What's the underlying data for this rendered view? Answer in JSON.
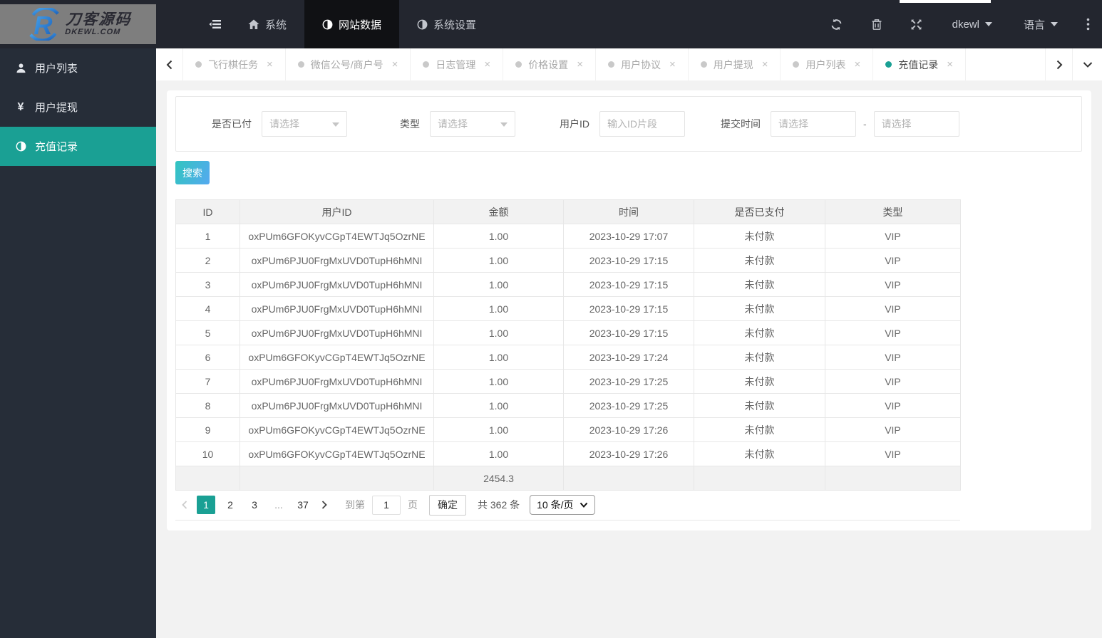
{
  "header": {
    "logo": {
      "title": "刀客源码",
      "subtitle": "DKEWL.COM"
    },
    "nav": [
      {
        "label": "系统",
        "icon": "home-icon",
        "active": false
      },
      {
        "label": "网站数据",
        "icon": "half-circle-icon",
        "active": true
      },
      {
        "label": "系统设置",
        "icon": "half-circle-icon",
        "active": false
      }
    ],
    "username": "dkewl",
    "language_label": "语言"
  },
  "tabs": [
    {
      "label": "飞行棋任务",
      "active": false
    },
    {
      "label": "微信公号/商户号",
      "active": false
    },
    {
      "label": "日志管理",
      "active": false
    },
    {
      "label": "价格设置",
      "active": false
    },
    {
      "label": "用户协议",
      "active": false
    },
    {
      "label": "用户提现",
      "active": false
    },
    {
      "label": "用户列表",
      "active": false
    },
    {
      "label": "充值记录",
      "active": true
    }
  ],
  "sidebar": {
    "items": [
      {
        "label": "用户列表",
        "icon": "user-icon",
        "active": false
      },
      {
        "label": "用户提现",
        "icon": "yen-icon",
        "active": false
      },
      {
        "label": "充值记录",
        "icon": "half-circle-icon",
        "active": true
      }
    ]
  },
  "filters": {
    "paid_label": "是否已付",
    "paid_placeholder": "请选择",
    "type_label": "类型",
    "type_placeholder": "请选择",
    "user_id_label": "用户ID",
    "user_id_placeholder": "输入ID片段",
    "time_label": "提交时间",
    "time_start_placeholder": "请选择",
    "time_end_placeholder": "请选择",
    "range_separator": "-"
  },
  "search_button_label": "搜索",
  "table": {
    "columns": [
      "ID",
      "用户ID",
      "金额",
      "时间",
      "是否已支付",
      "类型"
    ],
    "rows": [
      [
        "1",
        "oxPUm6GFOKyvCGpT4EWTJq5OzrNE",
        "1.00",
        "2023-10-29 17:07",
        "未付款",
        "VIP"
      ],
      [
        "2",
        "oxPUm6PJU0FrgMxUVD0TupH6hMNI",
        "1.00",
        "2023-10-29 17:15",
        "未付款",
        "VIP"
      ],
      [
        "3",
        "oxPUm6PJU0FrgMxUVD0TupH6hMNI",
        "1.00",
        "2023-10-29 17:15",
        "未付款",
        "VIP"
      ],
      [
        "4",
        "oxPUm6PJU0FrgMxUVD0TupH6hMNI",
        "1.00",
        "2023-10-29 17:15",
        "未付款",
        "VIP"
      ],
      [
        "5",
        "oxPUm6PJU0FrgMxUVD0TupH6hMNI",
        "1.00",
        "2023-10-29 17:15",
        "未付款",
        "VIP"
      ],
      [
        "6",
        "oxPUm6GFOKyvCGpT4EWTJq5OzrNE",
        "1.00",
        "2023-10-29 17:24",
        "未付款",
        "VIP"
      ],
      [
        "7",
        "oxPUm6PJU0FrgMxUVD0TupH6hMNI",
        "1.00",
        "2023-10-29 17:25",
        "未付款",
        "VIP"
      ],
      [
        "8",
        "oxPUm6PJU0FrgMxUVD0TupH6hMNI",
        "1.00",
        "2023-10-29 17:25",
        "未付款",
        "VIP"
      ],
      [
        "9",
        "oxPUm6GFOKyvCGpT4EWTJq5OzrNE",
        "1.00",
        "2023-10-29 17:26",
        "未付款",
        "VIP"
      ],
      [
        "10",
        "oxPUm6GFOKyvCGpT4EWTJq5OzrNE",
        "1.00",
        "2023-10-29 17:26",
        "未付款",
        "VIP"
      ]
    ],
    "summary_amount": "2454.3"
  },
  "pagination": {
    "pages": [
      "1",
      "2",
      "3",
      "...",
      "37"
    ],
    "active_page": "1",
    "goto_label": "到第",
    "goto_value": "1",
    "goto_unit": "页",
    "confirm_label": "确定",
    "total_label": "共 362 条",
    "page_size_label": "10 条/页"
  },
  "colors": {
    "accent": "#1aa094",
    "topbar": "#23262f",
    "sidebar": "#262d38",
    "search_gradient_start": "#31c5bf",
    "search_gradient_end": "#55a9f0"
  }
}
